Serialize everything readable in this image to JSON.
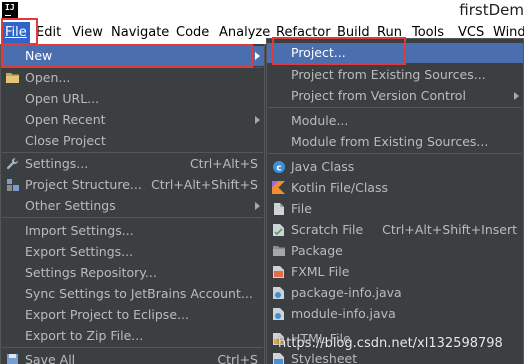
{
  "window": {
    "title": "firstDem"
  },
  "menubar": [
    {
      "label": "File"
    },
    {
      "label": "Edit"
    },
    {
      "label": "View"
    },
    {
      "label": "Navigate"
    },
    {
      "label": "Code"
    },
    {
      "label": "Analyze"
    },
    {
      "label": "Refactor"
    },
    {
      "label": "Build"
    },
    {
      "label": "Run"
    },
    {
      "label": "Tools"
    },
    {
      "label": "VCS"
    },
    {
      "label": "Wind"
    }
  ],
  "file_menu": [
    {
      "label": "New",
      "submenu": true,
      "selected": true
    },
    {
      "label": "Open...",
      "icon": "folder-icon"
    },
    {
      "label": "Open URL..."
    },
    {
      "label": "Open Recent",
      "submenu": true
    },
    {
      "label": "Close Project"
    },
    {
      "label": "Settings...",
      "shortcut": "Ctrl+Alt+S",
      "icon": "wrench-icon"
    },
    {
      "label": "Project Structure...",
      "shortcut": "Ctrl+Alt+Shift+S",
      "icon": "project-structure-icon"
    },
    {
      "label": "Other Settings",
      "submenu": true
    },
    {
      "label": "Import Settings..."
    },
    {
      "label": "Export Settings..."
    },
    {
      "label": "Settings Repository..."
    },
    {
      "label": "Sync Settings to JetBrains Account..."
    },
    {
      "label": "Export Project to Eclipse..."
    },
    {
      "label": "Export to Zip File..."
    },
    {
      "label": "Save All",
      "shortcut": "Ctrl+S",
      "icon": "save-icon"
    }
  ],
  "new_submenu": [
    {
      "label": "Project...",
      "selected": true
    },
    {
      "label": "Project from Existing Sources..."
    },
    {
      "label": "Project from Version Control",
      "submenu": true
    },
    {
      "label": "Module..."
    },
    {
      "label": "Module from Existing Sources..."
    },
    {
      "label": "Java Class",
      "icon": "java-class-icon"
    },
    {
      "label": "Kotlin File/Class",
      "icon": "kotlin-icon"
    },
    {
      "label": "File",
      "icon": "file-icon"
    },
    {
      "label": "Scratch File",
      "shortcut": "Ctrl+Alt+Shift+Insert",
      "icon": "scratch-file-icon"
    },
    {
      "label": "Package",
      "icon": "package-icon"
    },
    {
      "label": "FXML File",
      "icon": "fxml-file-icon"
    },
    {
      "label": "package-info.java",
      "icon": "java-file-icon"
    },
    {
      "label": "module-info.java",
      "icon": "java-file-icon"
    },
    {
      "label": "HTML File",
      "icon": "html-file-icon"
    },
    {
      "label": "Stylesheet",
      "icon": "stylesheet-icon"
    }
  ],
  "watermark": "https://blog.csdn.net/xl132598798",
  "colors": {
    "popup_background": "#3c3f41",
    "selection": "#4b6eaf",
    "menubar_active": "#2f65ca",
    "highlight_box": "#e03a3a"
  }
}
